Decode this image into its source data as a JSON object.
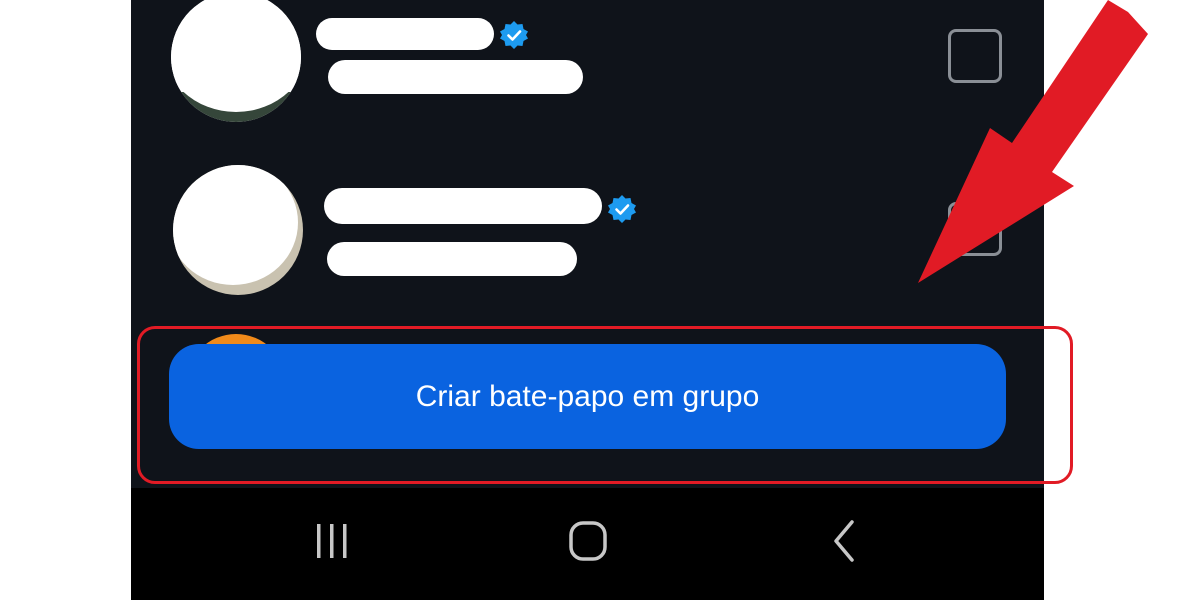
{
  "group_chat": {
    "create_button_label": "Criar bate-papo em grupo"
  },
  "icons": {
    "verified": "verified-badge-icon",
    "checkbox": "checkbox-icon",
    "recents": "recents-icon",
    "home": "home-icon",
    "back": "back-icon",
    "annotation_arrow": "arrow-icon"
  },
  "colors": {
    "screen_background": "#0f131a",
    "button_blue": "#0a63e0",
    "verified_blue": "#1d9bf0",
    "annotation_red": "#e11b25",
    "avatar_orange": "#f08a1a"
  }
}
